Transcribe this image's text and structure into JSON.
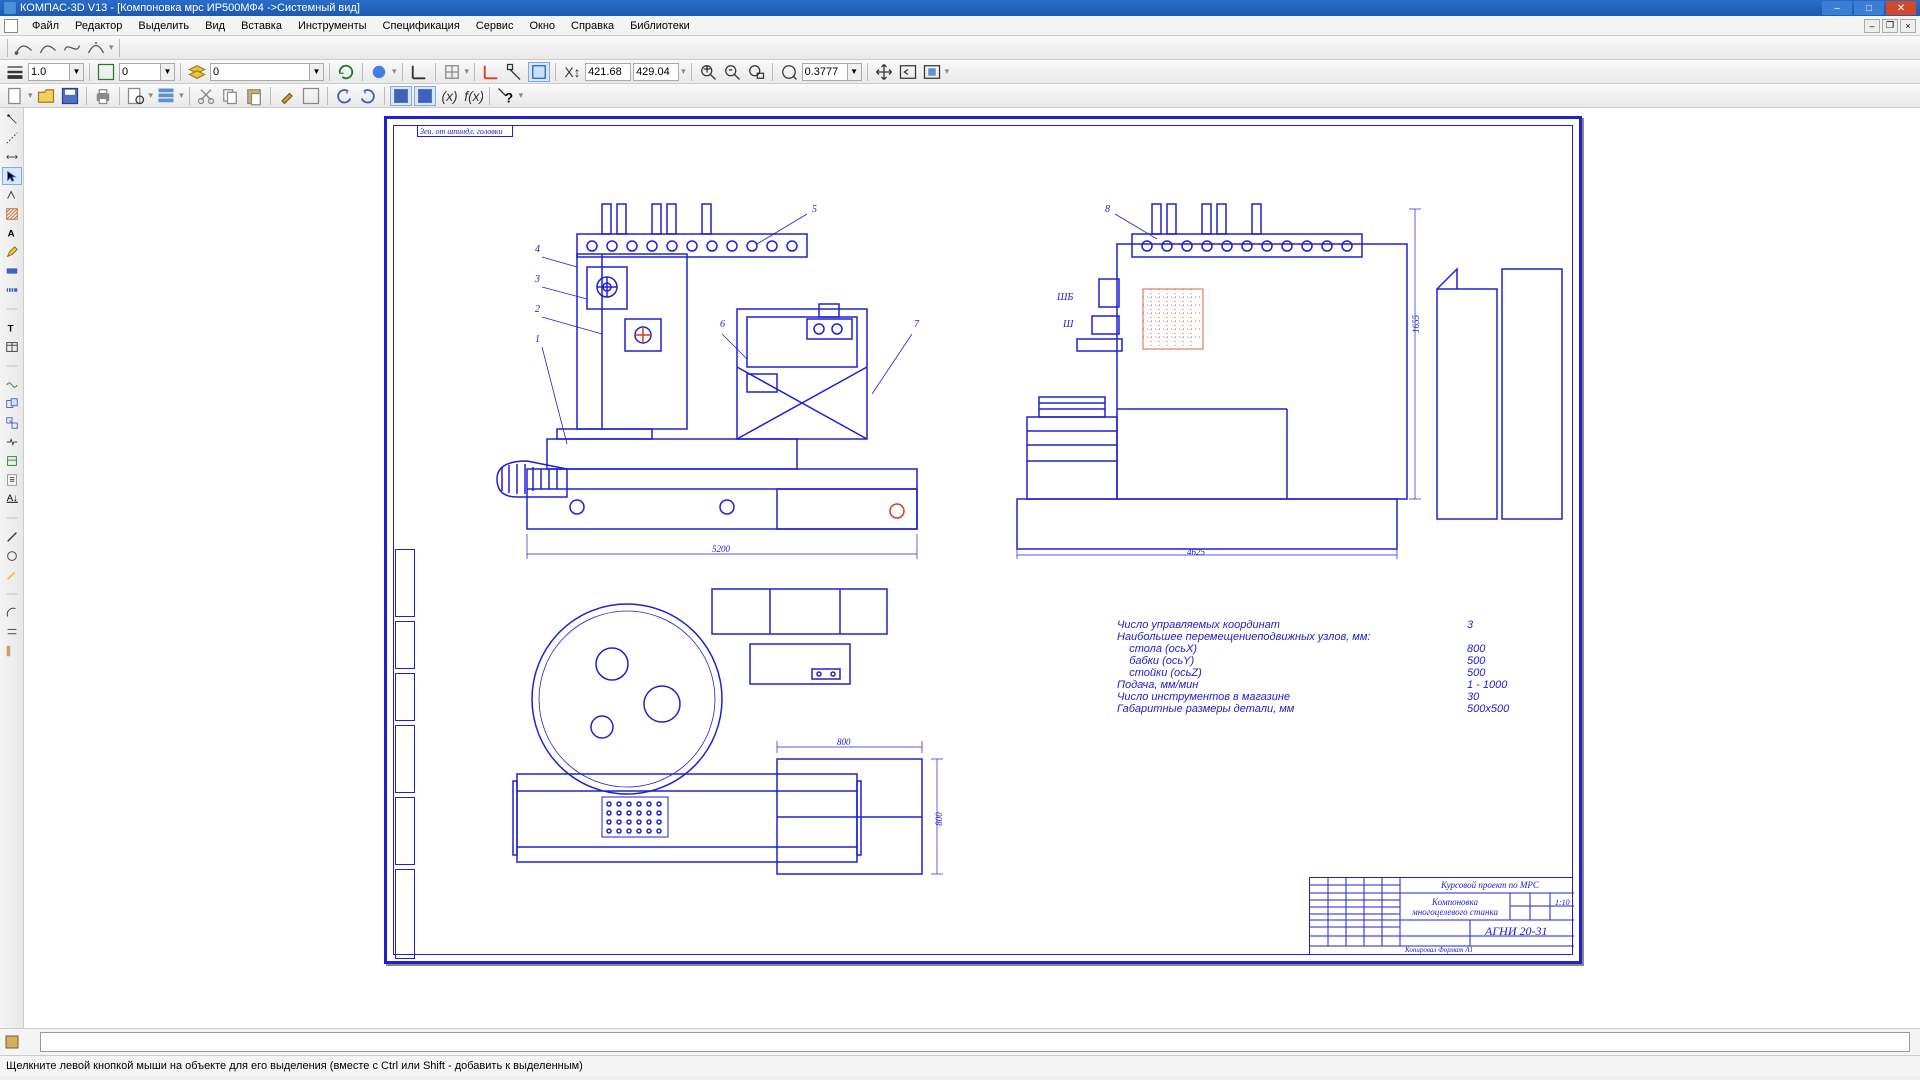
{
  "title": "КОМПАС-3D V13 - [Компоновка мрс ИР500МФ4 ->Системный вид]",
  "menu": {
    "items": [
      "Файл",
      "Редактор",
      "Выделить",
      "Вид",
      "Вставка",
      "Инструменты",
      "Спецификация",
      "Сервис",
      "Окно",
      "Справка",
      "Библиотеки"
    ]
  },
  "toolbar_vals": {
    "line_weight": "1.0",
    "style_num": "0",
    "layer_num": "0",
    "coord_x": "421.68",
    "coord_y": "429.04",
    "zoom": "0.3777"
  },
  "drawing": {
    "note_top": "Зен. от шпиндл. головки",
    "callouts_left": [
      "1",
      "2",
      "3",
      "4",
      "5",
      "6",
      "7",
      "8"
    ],
    "dims": {
      "front_width": "5200",
      "side_width": "4625",
      "side_height": "1655",
      "top_w": "800",
      "top_h": "800"
    },
    "labels": {
      "shb": "ШБ",
      "sh": "Ш"
    }
  },
  "spec": {
    "rows": [
      {
        "label": "Число управляемых координат",
        "val": "3"
      },
      {
        "label": "Наибольшее перемещениеподвижных узлов, мм:",
        "val": ""
      },
      {
        "label": "    стола (осьX)",
        "val": "800"
      },
      {
        "label": "    бабки (осьY)",
        "val": "500"
      },
      {
        "label": "    стойки (осьZ)",
        "val": "500"
      },
      {
        "label": "Подача, мм/мин",
        "val": "1 - 1000"
      },
      {
        "label": "Число инструментов в магазине",
        "val": "30"
      },
      {
        "label": "Габаритные размеры детали, мм",
        "val": "500х500"
      }
    ]
  },
  "title_block": {
    "line1": "Курсовой проект по МРС",
    "line2a": "Компоновка",
    "line2b": "многоцелевого станка",
    "code": "АГНИ 20-31",
    "scale": "1:10",
    "bottom": "Копировал     Формат  A1"
  },
  "status": "Щелкните левой кнопкой мыши на объекте для его выделения (вместе с Ctrl или Shift - добавить к выделенным)"
}
